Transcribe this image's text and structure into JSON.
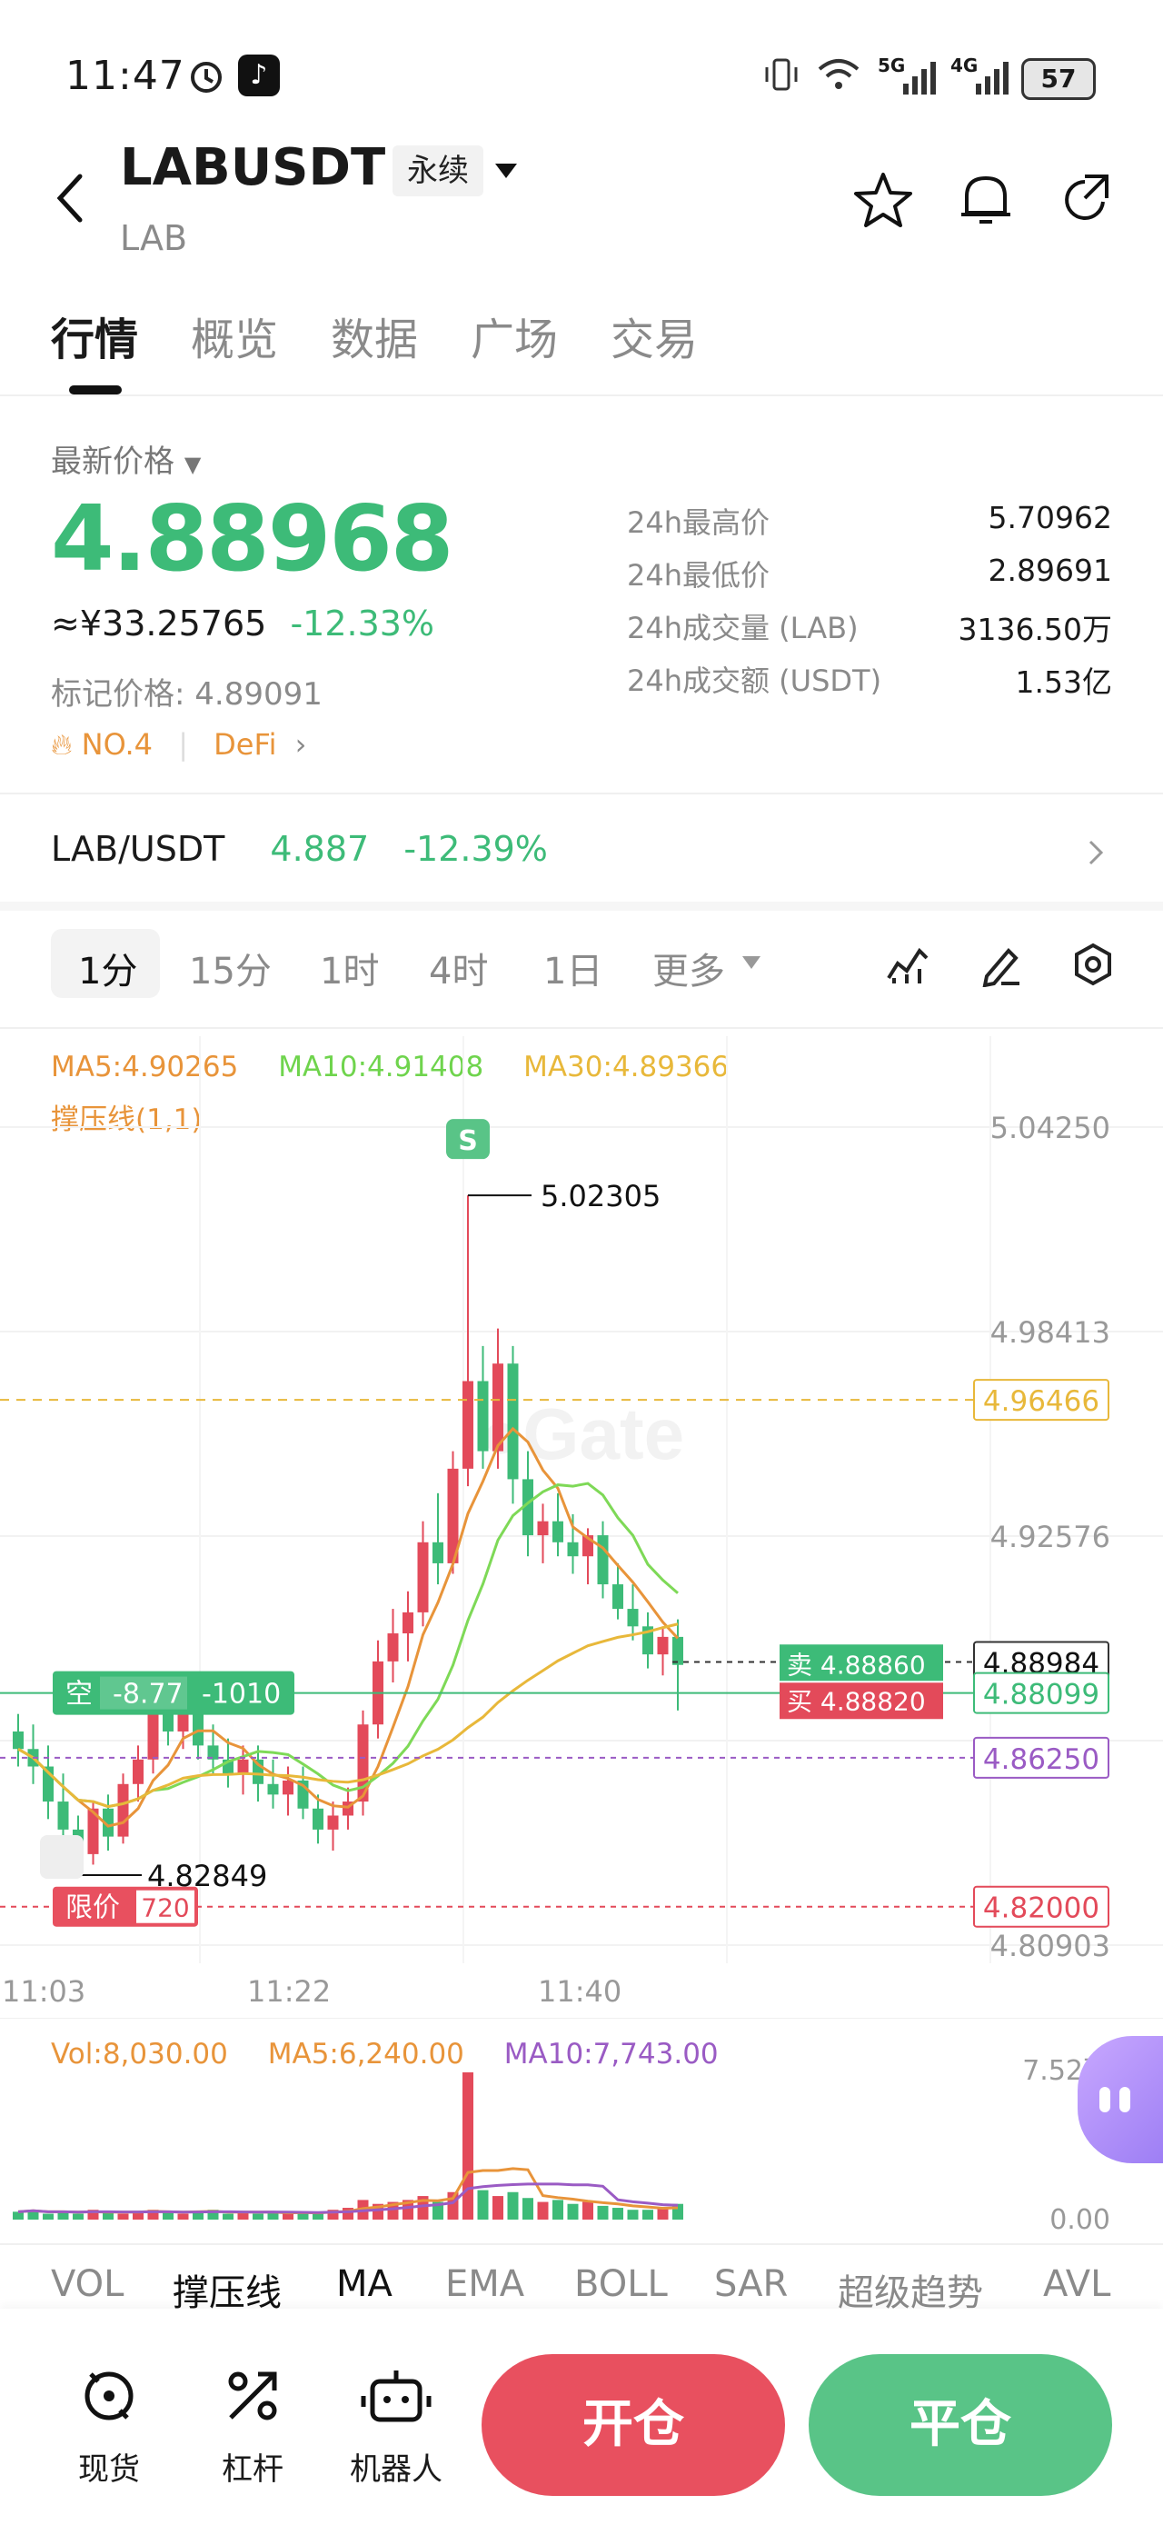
{
  "status_bar": {
    "time": "11:47",
    "battery": "57",
    "net1": "5G",
    "net2": "4G"
  },
  "header": {
    "symbol": "LABUSDT",
    "contract_type": "永续",
    "base": "LAB"
  },
  "tabs": [
    {
      "label": "行情",
      "active": true
    },
    {
      "label": "概览",
      "active": false
    },
    {
      "label": "数据",
      "active": false
    },
    {
      "label": "广场",
      "active": false
    },
    {
      "label": "交易",
      "active": false
    }
  ],
  "price": {
    "label": "最新价格",
    "last": "4.88968",
    "cny": "≈¥33.25765",
    "change_pct": "-12.33%",
    "mark_label": "标记价格: 4.89091",
    "rank": "NO.4",
    "sector": "DeFi"
  },
  "stats": [
    {
      "label": "24h最高价",
      "value": "5.70962"
    },
    {
      "label": "24h最低价",
      "value": "2.89691"
    },
    {
      "label": "24h成交量 (LAB)",
      "value": "3136.50万"
    },
    {
      "label": "24h成交额 (USDT)",
      "value": "1.53亿"
    }
  ],
  "spot_pair": {
    "pair": "LAB/USDT",
    "price": "4.887",
    "change": "-12.39%"
  },
  "timeframes": [
    {
      "label": "1分",
      "active": true
    },
    {
      "label": "15分",
      "active": false
    },
    {
      "label": "1时",
      "active": false
    },
    {
      "label": "4时",
      "active": false
    },
    {
      "label": "1日",
      "active": false
    },
    {
      "label": "更多",
      "active": false
    }
  ],
  "chart_legend": {
    "ma5": "MA5:4.90265",
    "ma10": "MA10:4.91408",
    "ma30": "MA30:4.89366",
    "sr": "撑压线(1,1)"
  },
  "chart_data": {
    "type": "candlestick",
    "interval": "1m",
    "y_ticks": [
      "5.04250",
      "4.98413",
      "4.92576",
      "4.80903"
    ],
    "ylim": [
      4.80903,
      5.0425
    ],
    "x_ticks": [
      "11:03",
      "11:22",
      "11:40"
    ],
    "high_marker": "5.02305",
    "low_marker": "4.82849",
    "signal": "S",
    "price_lines": [
      {
        "label": "4.96466",
        "value": 4.96466,
        "color": "#e8b83a"
      },
      {
        "label": "4.88984",
        "value": 4.88984,
        "color": "#333333"
      },
      {
        "label": "4.88099",
        "value": 4.88099,
        "color": "#3dbb78"
      },
      {
        "label": "4.86250",
        "value": 4.8625,
        "color": "#9a5bc4"
      },
      {
        "label": "4.82000",
        "value": 4.82,
        "color": "#e34a5a"
      }
    ],
    "orderbook": {
      "sell_label": "卖",
      "sell": "4.88860",
      "buy_label": "买",
      "buy": "4.88820"
    },
    "position": {
      "side": "空",
      "pnl": "-8.77",
      "qty": "-1010"
    },
    "limit_order": {
      "label": "限价",
      "qty": "720"
    },
    "candles": [
      {
        "o": 4.87,
        "h": 4.875,
        "l": 4.86,
        "c": 4.865
      },
      {
        "o": 4.865,
        "h": 4.872,
        "l": 4.855,
        "c": 4.86
      },
      {
        "o": 4.86,
        "h": 4.866,
        "l": 4.845,
        "c": 4.85
      },
      {
        "o": 4.85,
        "h": 4.858,
        "l": 4.838,
        "c": 4.842
      },
      {
        "o": 4.842,
        "h": 4.846,
        "l": 4.829,
        "c": 4.835
      },
      {
        "o": 4.835,
        "h": 4.85,
        "l": 4.832,
        "c": 4.848
      },
      {
        "o": 4.848,
        "h": 4.852,
        "l": 4.836,
        "c": 4.84
      },
      {
        "o": 4.84,
        "h": 4.858,
        "l": 4.838,
        "c": 4.855
      },
      {
        "o": 4.855,
        "h": 4.866,
        "l": 4.85,
        "c": 4.862
      },
      {
        "o": 4.862,
        "h": 4.878,
        "l": 4.858,
        "c": 4.875
      },
      {
        "o": 4.875,
        "h": 4.882,
        "l": 4.866,
        "c": 4.87
      },
      {
        "o": 4.87,
        "h": 4.88,
        "l": 4.865,
        "c": 4.878
      },
      {
        "o": 4.878,
        "h": 4.884,
        "l": 4.862,
        "c": 4.866
      },
      {
        "o": 4.866,
        "h": 4.872,
        "l": 4.858,
        "c": 4.862
      },
      {
        "o": 4.862,
        "h": 4.868,
        "l": 4.854,
        "c": 4.858
      },
      {
        "o": 4.858,
        "h": 4.866,
        "l": 4.852,
        "c": 4.862
      },
      {
        "o": 4.862,
        "h": 4.866,
        "l": 4.85,
        "c": 4.855
      },
      {
        "o": 4.855,
        "h": 4.862,
        "l": 4.848,
        "c": 4.852
      },
      {
        "o": 4.852,
        "h": 4.86,
        "l": 4.846,
        "c": 4.856
      },
      {
        "o": 4.856,
        "h": 4.86,
        "l": 4.845,
        "c": 4.848
      },
      {
        "o": 4.848,
        "h": 4.852,
        "l": 4.838,
        "c": 4.842
      },
      {
        "o": 4.842,
        "h": 4.85,
        "l": 4.836,
        "c": 4.846
      },
      {
        "o": 4.846,
        "h": 4.854,
        "l": 4.842,
        "c": 4.85
      },
      {
        "o": 4.85,
        "h": 4.876,
        "l": 4.846,
        "c": 4.872
      },
      {
        "o": 4.872,
        "h": 4.896,
        "l": 4.868,
        "c": 4.89
      },
      {
        "o": 4.89,
        "h": 4.905,
        "l": 4.884,
        "c": 4.898
      },
      {
        "o": 4.898,
        "h": 4.91,
        "l": 4.89,
        "c": 4.904
      },
      {
        "o": 4.904,
        "h": 4.93,
        "l": 4.9,
        "c": 4.924
      },
      {
        "o": 4.924,
        "h": 4.938,
        "l": 4.912,
        "c": 4.918
      },
      {
        "o": 4.918,
        "h": 4.95,
        "l": 4.915,
        "c": 4.945
      },
      {
        "o": 4.945,
        "h": 5.023,
        "l": 4.94,
        "c": 4.97
      },
      {
        "o": 4.97,
        "h": 4.98,
        "l": 4.945,
        "c": 4.95
      },
      {
        "o": 4.95,
        "h": 4.985,
        "l": 4.945,
        "c": 4.975
      },
      {
        "o": 4.975,
        "h": 4.98,
        "l": 4.935,
        "c": 4.942
      },
      {
        "o": 4.942,
        "h": 4.95,
        "l": 4.92,
        "c": 4.926
      },
      {
        "o": 4.926,
        "h": 4.935,
        "l": 4.918,
        "c": 4.93
      },
      {
        "o": 4.93,
        "h": 4.938,
        "l": 4.92,
        "c": 4.924
      },
      {
        "o": 4.924,
        "h": 4.932,
        "l": 4.915,
        "c": 4.92
      },
      {
        "o": 4.92,
        "h": 4.928,
        "l": 4.912,
        "c": 4.926
      },
      {
        "o": 4.926,
        "h": 4.93,
        "l": 4.908,
        "c": 4.912
      },
      {
        "o": 4.912,
        "h": 4.918,
        "l": 4.902,
        "c": 4.905
      },
      {
        "o": 4.905,
        "h": 4.912,
        "l": 4.896,
        "c": 4.9
      },
      {
        "o": 4.9,
        "h": 4.904,
        "l": 4.888,
        "c": 4.892
      },
      {
        "o": 4.892,
        "h": 4.9,
        "l": 4.886,
        "c": 4.897
      },
      {
        "o": 4.897,
        "h": 4.902,
        "l": 4.876,
        "c": 4.889
      }
    ],
    "volume": {
      "legend_vol": "Vol:8,030.00",
      "legend_ma5": "MA5:6,240.00",
      "legend_ma10": "MA10:7,743.00",
      "y_max": "7.52万",
      "y_min": "0.00",
      "values": [
        4,
        5,
        3,
        4,
        3,
        5,
        4,
        3,
        4,
        5,
        4,
        3,
        4,
        5,
        3,
        4,
        3,
        4,
        3,
        4,
        3,
        5,
        6,
        10,
        8,
        9,
        10,
        12,
        9,
        14,
        75,
        15,
        12,
        14,
        11,
        9,
        10,
        8,
        9,
        7,
        6,
        5,
        5,
        6,
        8
      ]
    }
  },
  "indicator_tabs": [
    "VOL",
    "撑压线",
    "MA",
    "EMA",
    "BOLL",
    "SAR",
    "超级趋势",
    "AVL"
  ],
  "bottom_nav": [
    {
      "label": "现货",
      "icon": "spot-icon"
    },
    {
      "label": "杠杆",
      "icon": "leverage-icon"
    },
    {
      "label": "机器人",
      "icon": "robot-icon"
    }
  ],
  "actions": {
    "open": "开仓",
    "close": "平仓"
  },
  "colors": {
    "green": "#3dbb78",
    "red": "#e34a5a",
    "ma5": "#e8943a",
    "ma10": "#7ed957",
    "ma30": "#e8b83a"
  }
}
